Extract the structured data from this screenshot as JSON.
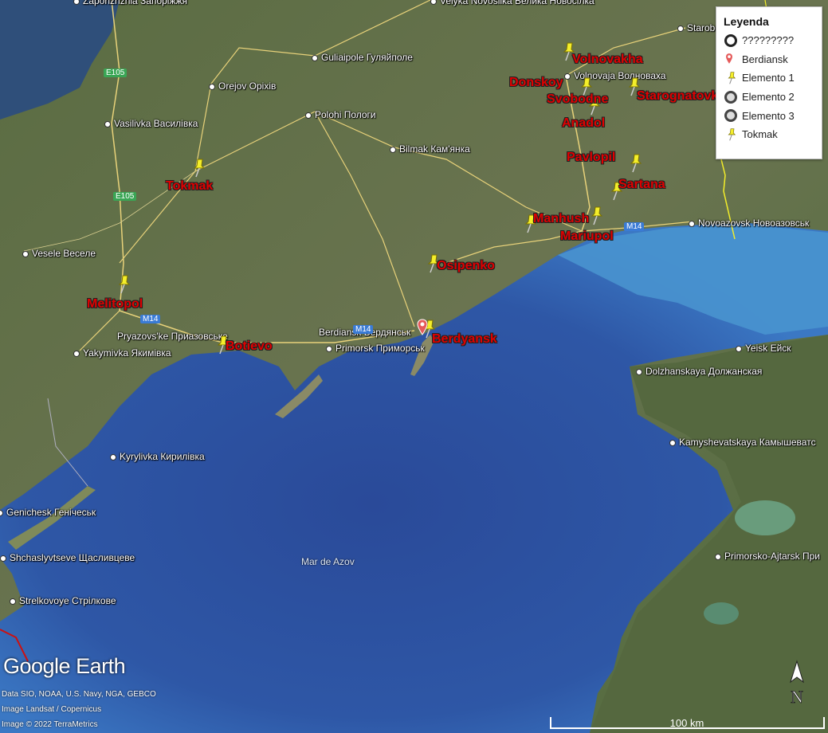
{
  "legend": {
    "title": "Leyenda",
    "items": [
      {
        "label": "?????????",
        "icon": "ring-icon"
      },
      {
        "label": "Berdiansk",
        "icon": "red-pin-icon"
      },
      {
        "label": "Elemento 1",
        "icon": "yellow-pushpin-icon"
      },
      {
        "label": "Elemento 2",
        "icon": "ring-icon"
      },
      {
        "label": "Elemento 3",
        "icon": "ring-icon"
      },
      {
        "label": "Tokmak",
        "icon": "yellow-pushpin-icon"
      }
    ]
  },
  "places": {
    "zaporizhzhia": "Zaporizhzhia Запоріжжя",
    "velyka_novosilka": "Velyka Novosilka Велика Новосілка",
    "starobesheve": "Starobesheve Старобешеве",
    "huliaipole": "Guliaipole Гуляйполе",
    "orejov": "Orejov Оріхів",
    "volnovakha": "Volnovaja Волноваха",
    "vasylivka": "Vasilivka Василівка",
    "polohy": "Polohi Пологи",
    "bilmak": "Bilmak Кам'янка",
    "vesele": "Vesele Веселе",
    "novoazovsk": "Novoazovsk Новоазовськ",
    "pryazovske": "Pryazovs'ke Приазовське",
    "berdiansk": "Berdiansk Бердянськ",
    "yakymivka": "Yakymivka Якимівка",
    "primorsk": "Primorsk Приморськ",
    "yeisk": "Yeisk Ейск",
    "dolzhanskaya": "Dolzhanskaya Должанская",
    "kamyshevatskaya": "Kamyshevatskaya Камышеватс",
    "kyrylivka": "Kyrylivka Кирилівка",
    "genichesk": "Genichesk Генічеськ",
    "primorsko_akhtarsk": "Primorsko-Ajtarsk При",
    "shchaslyvtseve": "Shchaslyvtseve Щасливцеве",
    "strilkove": "Strelkovoye Стрілкове"
  },
  "sea_label": "Mar de Azov",
  "road_shields": {
    "e105_top": "E105",
    "e105_mid": "E105",
    "m14_west": "M14",
    "m14_east": "M14",
    "m14_berd": "M14"
  },
  "markers": {
    "volnovakha": "Volnovakha",
    "donskoy": "Donskoy",
    "svobodne": "Svobodne",
    "starognatovka": "Starognatovka",
    "anadol": "Anadol",
    "pavlopil": "Pavlopil",
    "sartana": "Sartana",
    "tokmak": "Tokmak",
    "manhush": "Manhush",
    "mariupol": "Mariupol",
    "osipenko": "Osipenko",
    "melitopol": "Melitopol",
    "botievo": "Botievo",
    "berdyansk": "Berdyansk"
  },
  "branding": {
    "logo_google": "Google",
    "logo_earth": "Earth",
    "credit_data": "Data SIO, NOAA, U.S. Navy, NGA, GEBCO",
    "credit_image1": "Image Landsat / Copernicus",
    "credit_image2": "Image © 2022 TerraMetrics"
  },
  "compass_letter": "N",
  "scale_label": "100 km",
  "colors": {
    "marker_label": "#e00000",
    "pushpin": "#f4ee2a",
    "sea": "#2f5aa6",
    "shallow": "#4fa4d9",
    "land": "#5d6e45"
  }
}
